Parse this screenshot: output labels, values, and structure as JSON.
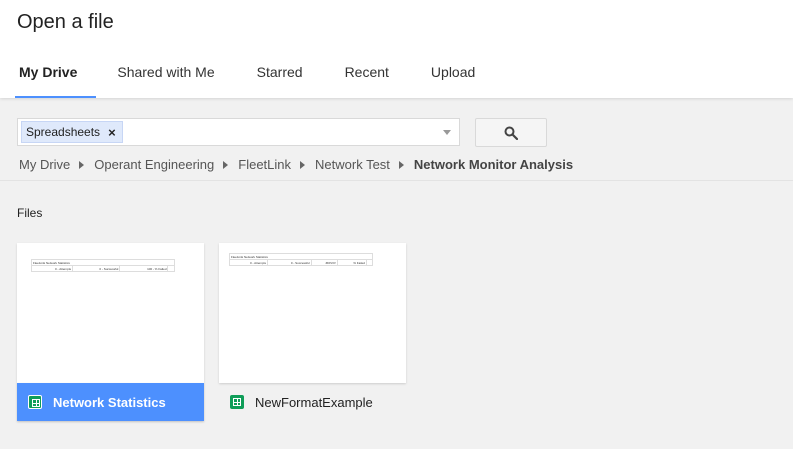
{
  "dialog": {
    "title": "Open a file"
  },
  "tabs": [
    {
      "label": "My Drive",
      "active": true
    },
    {
      "label": "Shared with Me",
      "active": false
    },
    {
      "label": "Starred",
      "active": false
    },
    {
      "label": "Recent",
      "active": false
    },
    {
      "label": "Upload",
      "active": false
    }
  ],
  "search": {
    "filter_chip": "Spreadsheets",
    "chip_remove": "×",
    "button_icon": "search-icon"
  },
  "breadcrumb": [
    "My Drive",
    "Operant Engineering",
    "FleetLink",
    "Network Test",
    "Network Monitor Analysis"
  ],
  "files": {
    "section_label": "Files",
    "items": [
      {
        "name": "Network Statistics",
        "selected": true,
        "icon": "spreadsheet-icon",
        "preview": {
          "title": "FleetLink Network Statistics",
          "cells": [
            "0 - Attempts",
            "0 - Successful",
            "100 - % Failed"
          ]
        }
      },
      {
        "name": "NewFormatExample",
        "selected": false,
        "icon": "spreadsheet-icon",
        "preview": {
          "title": "FleetLink Network Statistics",
          "cells": [
            "0 - Attempts",
            "0 - Successful",
            "#DIV/0!",
            "% Failed"
          ]
        }
      }
    ]
  },
  "colors": {
    "accent": "#4d90fe",
    "sheets_green": "#0f9d58"
  }
}
